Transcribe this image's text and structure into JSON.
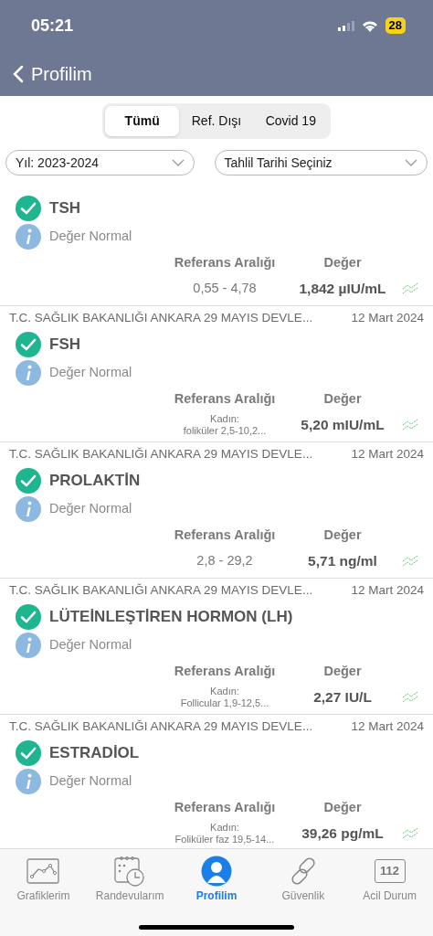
{
  "status_bar": {
    "time": "05:21",
    "battery": "28"
  },
  "nav": {
    "back_label": "Profilim"
  },
  "segments": [
    {
      "label": "Tümü",
      "selected": true
    },
    {
      "label": "Ref. Dışı",
      "selected": false
    },
    {
      "label": "Covid 19",
      "selected": false
    }
  ],
  "filters": [
    {
      "value": "Yıl: 2023-2024"
    },
    {
      "value": "Tahlil Tarihi Seçiniz"
    }
  ],
  "results": [
    {
      "test": "TSH",
      "status": "Değer Normal",
      "range_label": "Referans Aralığı",
      "value_label": "Değer",
      "range": "0,55 - 4,78",
      "value": "1,842 µIU/mL"
    },
    {
      "hospital": "T.C. SAĞLIK BAKANLIĞI ANKARA 29 MAYIS DEVLE...",
      "date": "12 Mart 2024",
      "test": "FSH",
      "status": "Değer Normal",
      "range_label": "Referans Aralığı",
      "value_label": "Değer",
      "range_note": "Kadın:",
      "range": "foliküler 2,5-10,2...",
      "value": "5,20 mIU/mL"
    },
    {
      "hospital": "T.C. SAĞLIK BAKANLIĞI ANKARA 29 MAYIS DEVLE...",
      "date": "12 Mart 2024",
      "test": "PROLAKTİN",
      "status": "Değer Normal",
      "range_label": "Referans Aralığı",
      "value_label": "Değer",
      "range": "2,8 - 29,2",
      "value": "5,71 ng/ml"
    },
    {
      "hospital": "T.C. SAĞLIK BAKANLIĞI ANKARA 29 MAYIS DEVLE...",
      "date": "12 Mart 2024",
      "test": "LÜTEİNLEŞTİREN HORMON (LH)",
      "status": "Değer Normal",
      "range_label": "Referans Aralığı",
      "value_label": "Değer",
      "range_note": "Kadın:",
      "range": "Follicular 1,9-12,5...",
      "value": "2,27 IU/L"
    },
    {
      "hospital": "T.C. SAĞLIK BAKANLIĞI ANKARA 29 MAYIS DEVLE...",
      "date": "12 Mart 2024",
      "test": "ESTRADİOL",
      "status": "Değer Normal",
      "range_label": "Referans Aralığı",
      "value_label": "Değer",
      "range_note": "Kadın:",
      "range": "Foliküler faz 19,5-14...",
      "value": "39,26 pg/mL"
    }
  ],
  "tab_bar": [
    {
      "kind": "chart",
      "label": "Grafiklerim",
      "selected": false
    },
    {
      "kind": "calendar",
      "label": "Randevularım",
      "selected": false
    },
    {
      "kind": "person",
      "label": "Profilim",
      "selected": true
    },
    {
      "kind": "link",
      "label": "Güvenlik",
      "selected": false
    },
    {
      "kind": "emergency",
      "label": "Acil Durum",
      "icon_text": "112",
      "selected": false
    }
  ]
}
